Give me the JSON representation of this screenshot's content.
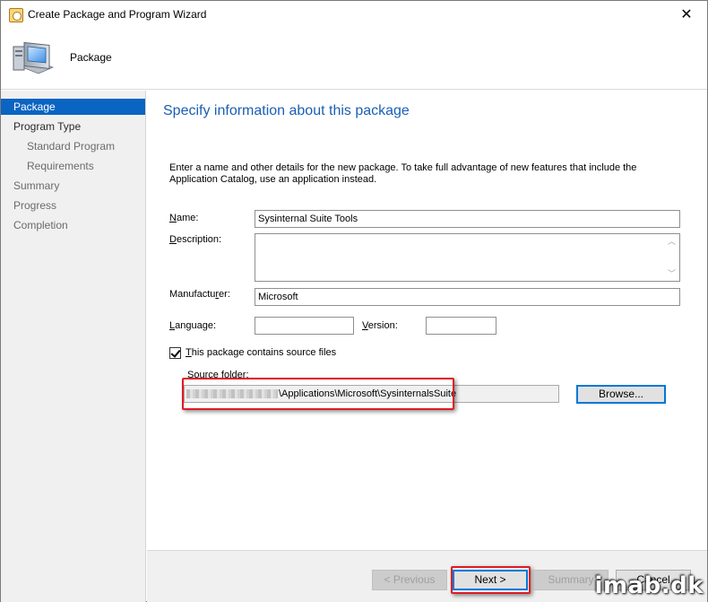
{
  "window": {
    "title": "Create Package and Program Wizard",
    "close_glyph": "✕"
  },
  "header": {
    "title": "Package",
    "icon": "computer-icon"
  },
  "sidebar": {
    "items": [
      {
        "label": "Package",
        "selected": true
      },
      {
        "label": "Program Type",
        "selected": false
      },
      {
        "label": "Standard Program",
        "selected": false
      },
      {
        "label": "Requirements",
        "selected": false
      },
      {
        "label": "Summary",
        "selected": false
      },
      {
        "label": "Progress",
        "selected": false
      },
      {
        "label": "Completion",
        "selected": false
      }
    ]
  },
  "main": {
    "title": "Specify information about this package",
    "intro": "Enter a name and other details for the new package. To take full advantage of new features that include the Application Catalog, use an application instead.",
    "fields": {
      "name": {
        "label_u": "N",
        "label_rest": "ame:",
        "value": "Sysinternal Suite Tools"
      },
      "description": {
        "label_u": "D",
        "label_rest": "escription:",
        "value": ""
      },
      "manufacturer": {
        "label_pre": "Manufactu",
        "label_u": "r",
        "label_rest": "er:",
        "value": "Microsoft"
      },
      "language": {
        "label_u": "L",
        "label_rest": "anguage:",
        "value": ""
      },
      "version": {
        "label_u": "V",
        "label_rest": "ersion:",
        "value": ""
      }
    },
    "source_checkbox": {
      "label_u": "T",
      "label_rest": "his package contains source files",
      "checked": true
    },
    "source_folder": {
      "label_pre": "Sour",
      "label_u": "c",
      "label_rest": "e folder:",
      "value": "\\Applications\\Microsoft\\SysinternalsSuite"
    },
    "browse_label": "Browse..."
  },
  "footer": {
    "previous_label": "< Previous",
    "next_label": "Next >",
    "summary_label": "Summary",
    "cancel_label": "Cancel"
  },
  "watermark": "imab.dk",
  "colors": {
    "accent": "#0a64c2",
    "title_blue": "#1a5fb4",
    "highlight_red": "#e01b24"
  }
}
